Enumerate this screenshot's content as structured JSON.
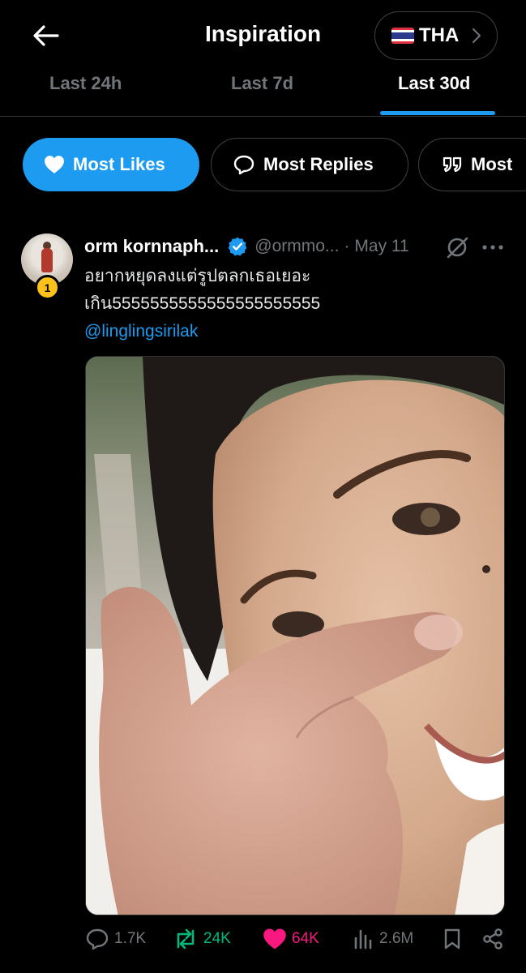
{
  "header": {
    "title": "Inspiration",
    "country_code": "THA",
    "country_flag": "thailand-flag-icon"
  },
  "tabs": [
    {
      "label": "Last 24h",
      "active": false
    },
    {
      "label": "Last 7d",
      "active": false
    },
    {
      "label": "Last 30d",
      "active": true
    }
  ],
  "filters": [
    {
      "label": "Most Likes",
      "icon": "heart-icon",
      "active": true
    },
    {
      "label": "Most Replies",
      "icon": "reply-icon",
      "active": false
    },
    {
      "label": "Most",
      "icon": "quote-icon",
      "active": false
    }
  ],
  "post": {
    "rank": "1",
    "display_name": "orm kornnaph...",
    "verified": true,
    "handle": "@ormmo...",
    "separator": "·",
    "date": "May 11",
    "text_line1": "อยากหยุดลงแต่รูปตลกเธอเยอะ",
    "text_line2": "เกิน5555555555555555555555",
    "mention": "@linglingsirilak",
    "stats": {
      "replies": "1.7K",
      "reposts": "24K",
      "likes": "64K",
      "views": "2.6M"
    }
  },
  "colors": {
    "accent": "#1d9bf0",
    "repost": "#00ba7c",
    "like": "#f91880",
    "muted": "#71767b",
    "rank_badge": "#fcc21b"
  }
}
